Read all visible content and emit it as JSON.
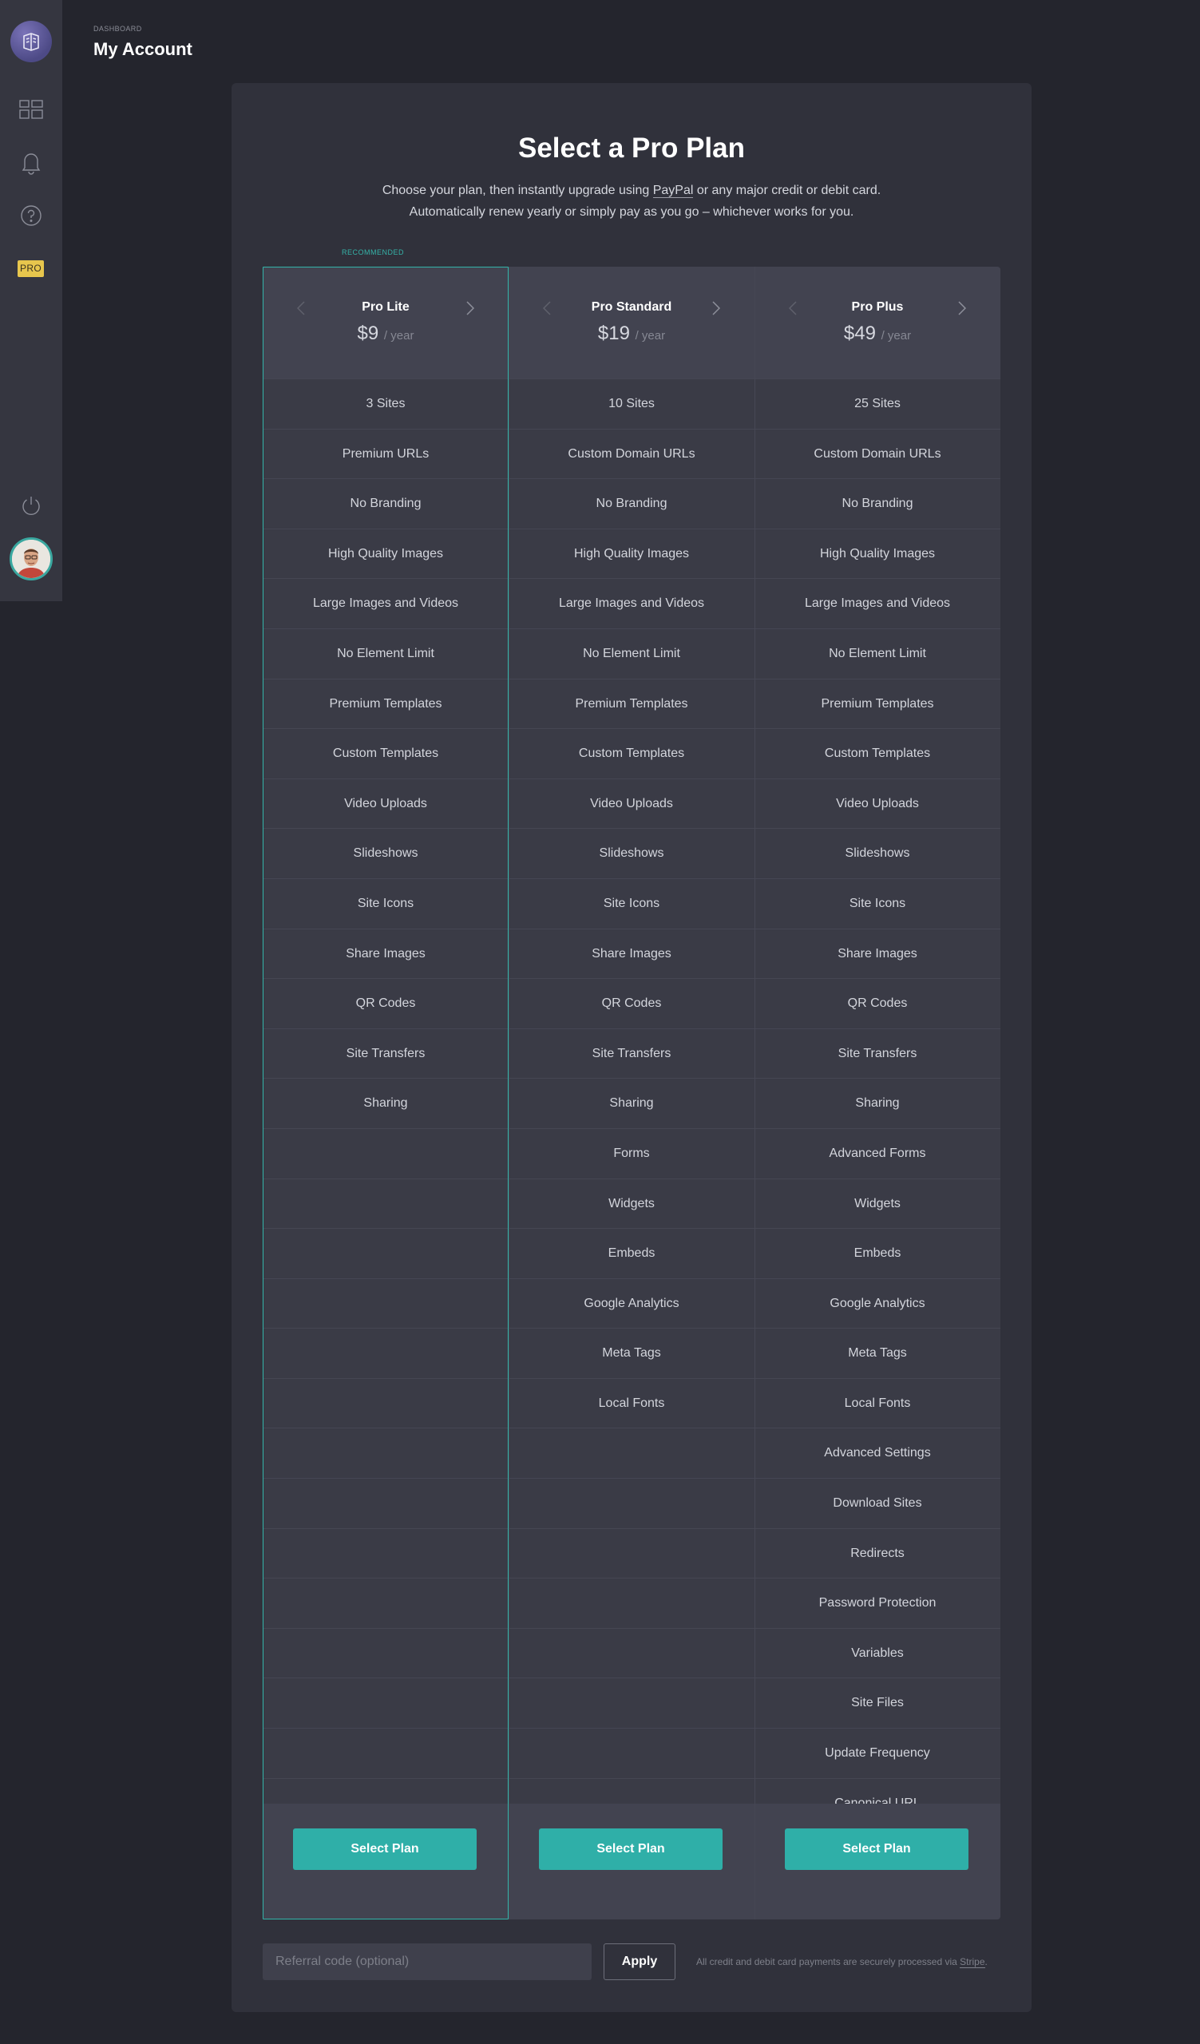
{
  "header": {
    "breadcrumb": "DASHBOARD",
    "title": "My Account"
  },
  "sidebar": {
    "pro_badge": "PRO",
    "icons": [
      "logo-icon",
      "dashboard-grid-icon",
      "bell-icon",
      "help-icon",
      "power-icon"
    ]
  },
  "plans_section": {
    "title": "Select a Pro Plan",
    "desc_line1_pre": "Choose your plan, then instantly upgrade using ",
    "desc_link": "PayPal",
    "desc_line1_post": " or any major credit or debit card.",
    "desc_line2": "Automatically renew yearly or simply pay as you go – whichever works for you.",
    "recommended": "RECOMMENDED"
  },
  "plans": [
    {
      "name": "Pro Lite",
      "price": "$9",
      "period": "/ year",
      "features": [
        "3 Sites",
        "Premium URLs",
        "No Branding",
        "High Quality Images",
        "Large Images and Videos",
        "No Element Limit",
        "Premium Templates",
        "Custom Templates",
        "Video Uploads",
        "Slideshows",
        "Site Icons",
        "Share Images",
        "QR Codes",
        "Site Transfers",
        "Sharing",
        "",
        "",
        "",
        "",
        "",
        "",
        "",
        "",
        "",
        "",
        "",
        "",
        "",
        ""
      ],
      "button": "Select Plan"
    },
    {
      "name": "Pro Standard",
      "price": "$19",
      "period": "/ year",
      "features": [
        "10 Sites",
        "Custom Domain URLs",
        "No Branding",
        "High Quality Images",
        "Large Images and Videos",
        "No Element Limit",
        "Premium Templates",
        "Custom Templates",
        "Video Uploads",
        "Slideshows",
        "Site Icons",
        "Share Images",
        "QR Codes",
        "Site Transfers",
        "Sharing",
        "Forms",
        "Widgets",
        "Embeds",
        "Google Analytics",
        "Meta Tags",
        "Local Fonts",
        "",
        "",
        "",
        "",
        "",
        "",
        "",
        ""
      ],
      "button": "Select Plan"
    },
    {
      "name": "Pro Plus",
      "price": "$49",
      "period": "/ year",
      "features": [
        "25 Sites",
        "Custom Domain URLs",
        "No Branding",
        "High Quality Images",
        "Large Images and Videos",
        "No Element Limit",
        "Premium Templates",
        "Custom Templates",
        "Video Uploads",
        "Slideshows",
        "Site Icons",
        "Share Images",
        "QR Codes",
        "Site Transfers",
        "Sharing",
        "Advanced Forms",
        "Widgets",
        "Embeds",
        "Google Analytics",
        "Meta Tags",
        "Local Fonts",
        "Advanced Settings",
        "Download Sites",
        "Redirects",
        "Password Protection",
        "Variables",
        "Site Files",
        "Update Frequency",
        "Canonical URL"
      ],
      "button": "Select Plan"
    }
  ],
  "referral": {
    "placeholder": "Referral code (optional)",
    "apply": "Apply",
    "note_pre": "All credit and debit card payments are securely processed via ",
    "note_link": "Stripe",
    "note_post": "."
  },
  "colors": {
    "accent": "#2fafa8",
    "background": "#24252d",
    "panel": "#30313b",
    "pro_badge": "#e7c64d"
  }
}
